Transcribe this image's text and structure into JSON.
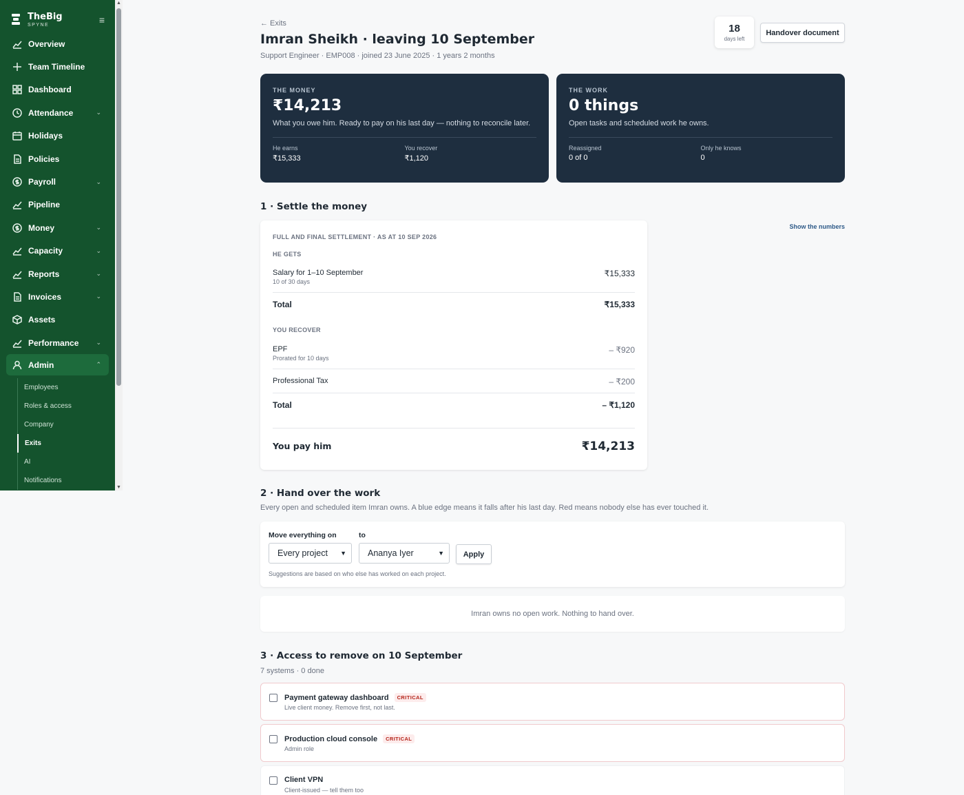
{
  "brand": {
    "name": "TheBig",
    "sub": "SPYNE"
  },
  "sidebar": {
    "items": [
      {
        "label": "Overview",
        "icon": "chart-line-icon",
        "chevron": false
      },
      {
        "label": "Team Timeline",
        "icon": "plus-icon",
        "chevron": false
      },
      {
        "label": "Dashboard",
        "icon": "grid-icon",
        "chevron": false
      },
      {
        "label": "Attendance",
        "icon": "clock-icon",
        "chevron": true
      },
      {
        "label": "Holidays",
        "icon": "calendar-icon",
        "chevron": false
      },
      {
        "label": "Policies",
        "icon": "document-icon",
        "chevron": false
      },
      {
        "label": "Payroll",
        "icon": "dollar-coin-icon",
        "chevron": true
      },
      {
        "label": "Pipeline",
        "icon": "chart-line-icon",
        "chevron": false
      },
      {
        "label": "Money",
        "icon": "dollar-coin-icon",
        "chevron": true
      },
      {
        "label": "Capacity",
        "icon": "chart-line-icon",
        "chevron": true
      },
      {
        "label": "Reports",
        "icon": "chart-line-icon",
        "chevron": true
      },
      {
        "label": "Invoices",
        "icon": "document-icon",
        "chevron": true
      },
      {
        "label": "Assets",
        "icon": "box-icon",
        "chevron": false
      },
      {
        "label": "Performance",
        "icon": "chart-line-icon",
        "chevron": true
      },
      {
        "label": "Admin",
        "icon": "user-icon",
        "chevron": true
      }
    ],
    "admin_sub": [
      "Employees",
      "Roles & access",
      "Company",
      "Exits",
      "AI",
      "Notifications"
    ],
    "active_sub": "Exits"
  },
  "header": {
    "back": "← Exits",
    "title": "Imran Sheikh · leaving 10 September",
    "subtitle": "Support Engineer · EMP008 · joined 23 June 2025 · 1 years 2 months",
    "days_left": "18",
    "days_left_label": "days left",
    "handover_button": "Handover document"
  },
  "money_card": {
    "label": "THE MONEY",
    "value": "₹14,213",
    "desc": "What you owe him. Ready to pay on his last day — nothing to reconcile later.",
    "stat1_label": "He earns",
    "stat1_value": "₹15,333",
    "stat2_label": "You recover",
    "stat2_value": "₹1,120"
  },
  "work_card": {
    "label": "THE WORK",
    "value": "0 things",
    "desc": "Open tasks and scheduled work he owns.",
    "stat1_label": "Reassigned",
    "stat1_value": "0 of 0",
    "stat2_label": "Only he knows",
    "stat2_value": "0"
  },
  "settle": {
    "section_title": "1 · Settle the money",
    "show_numbers": "Show the numbers",
    "caption": "FULL AND FINAL SETTLEMENT · AS AT 10 SEP 2026",
    "gets_label": "HE GETS",
    "gets_items": [
      {
        "label": "Salary for 1–10 September",
        "sub": "10 of 30 days",
        "amount": "₹15,333"
      }
    ],
    "gets_total_label": "Total",
    "gets_total": "₹15,333",
    "recover_label": "YOU RECOVER",
    "recover_items": [
      {
        "label": "EPF",
        "sub": "Prorated for 10 days",
        "amount": "– ₹920"
      },
      {
        "label": "Professional Tax",
        "sub": "",
        "amount": "– ₹200"
      }
    ],
    "recover_total_label": "Total",
    "recover_total": "– ₹1,120",
    "pay_label": "You pay him",
    "pay_value": "₹14,213"
  },
  "handover": {
    "section_title": "2 · Hand over the work",
    "desc": "Every open and scheduled item Imran owns. A blue edge means it falls after his last day. Red means nobody else has ever touched it.",
    "move_label": "Move everything on",
    "to_label": "to",
    "project_select": "Every project",
    "person_select": "Ananya Iyer",
    "apply": "Apply",
    "hint": "Suggestions are based on who else has worked on each project.",
    "empty": "Imran owns no open work. Nothing to hand over."
  },
  "access": {
    "section_title": "3 · Access to remove on 10 September",
    "summary": "7 systems · 0 done",
    "items": [
      {
        "name": "Payment gateway dashboard",
        "badge": "CRITICAL",
        "desc": "Live client money. Remove first, not last."
      },
      {
        "name": "Production cloud console",
        "badge": "CRITICAL",
        "desc": "Admin role"
      },
      {
        "name": "Client VPN",
        "badge": "",
        "desc": "Client-issued — tell them too"
      }
    ]
  }
}
